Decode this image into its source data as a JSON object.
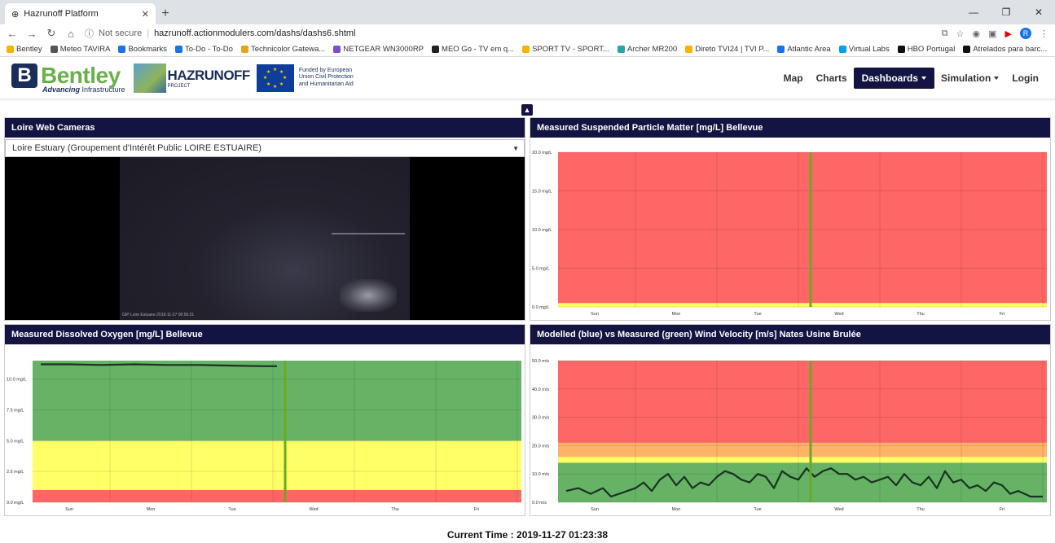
{
  "browser": {
    "tab_title": "Hazrunoff Platform",
    "secure_label": "Not secure",
    "url": "hazrunoff.actionmodulers.com/dashs/dashs6.shtml",
    "avatar_letter": "R",
    "bookmarks": [
      {
        "label": "Bentley",
        "color": "#f4b400"
      },
      {
        "label": "Meteo TAVIRA",
        "color": "#555555"
      },
      {
        "label": "Bookmarks",
        "color": "#1a73e8"
      },
      {
        "label": "To-Do - To-Do",
        "color": "#1a73e8"
      },
      {
        "label": "Technicolor Gatewa...",
        "color": "#e8a317"
      },
      {
        "label": "NETGEAR WN3000RP",
        "color": "#7b4fd1"
      },
      {
        "label": "MEO Go - TV em q...",
        "color": "#222222"
      },
      {
        "label": "SPORT TV - SPORT...",
        "color": "#f4b400"
      },
      {
        "label": "Archer MR200",
        "color": "#2aa6a6"
      },
      {
        "label": "Direto TVI24 | TVI P...",
        "color": "#f4b400"
      },
      {
        "label": "Atlantic Area",
        "color": "#1a73e8"
      },
      {
        "label": "Virtual Labs",
        "color": "#00a1f1"
      },
      {
        "label": "HBO Portugal",
        "color": "#111111"
      },
      {
        "label": "Atrelados para barc...",
        "color": "#111111"
      }
    ],
    "bookmarks_more": "»"
  },
  "header": {
    "bentley_word": "Bentley",
    "bentley_tag_bold": "Advancing",
    "bentley_tag_rest": " Infrastructure",
    "haz_title": "HAZRUNOFF",
    "haz_sub": "PROJECT",
    "eu_text": "Funded by European Union Civil Protection and Humanitarian Aid",
    "nav": {
      "map": "Map",
      "charts": "Charts",
      "dashboards": "Dashboards",
      "simulation": "Simulation",
      "login": "Login"
    }
  },
  "panels": {
    "cameras": {
      "title": "Loire Web Cameras",
      "selected": "Loire Estuary (Groupement d'Intérêt Public LOIRE ESTUAIRE)",
      "timestamp": "GIP Loire Estuaire 2019-11-27 00:56:21"
    },
    "spm": {
      "title": "Measured Suspended Particle Matter [mg/L] Bellevue"
    },
    "oxygen": {
      "title": "Measured Dissolved Oxygen [mg/L] Bellevue"
    },
    "wind": {
      "title": "Modelled (blue) vs Measured (green) Wind Velocity [m/s] Nates Usine Brulée"
    }
  },
  "footer": {
    "current_time": "Current Time : 2019-11-27  01:23:38"
  },
  "colors": {
    "red": "#ff6666",
    "green": "#66b366",
    "yellow": "#ffff66",
    "orange": "#ffb366",
    "now_line": "#6aa82a",
    "series": "#1a3320",
    "header_bg": "#141443"
  },
  "chart_data": [
    {
      "id": "spm",
      "type": "area",
      "title": "Measured Suspended Particle Matter [mg/L] Bellevue",
      "categories": [
        "Sun",
        "Mon",
        "Tue",
        "Wed",
        "Thu",
        "Fri"
      ],
      "yticks": [
        "0.0 mg/L",
        "5.0 mg/L",
        "10.0 mg/L",
        "15.0 mg/L",
        "20.0 mg/L"
      ],
      "ylim": [
        0,
        20
      ],
      "bands": [
        {
          "from": 0,
          "to": 0.5,
          "color": "yellow"
        },
        {
          "from": 0.5,
          "to": 20,
          "color": "red"
        }
      ],
      "now_x": 2.65,
      "series": []
    },
    {
      "id": "oxygen",
      "type": "line",
      "title": "Measured Dissolved Oxygen [mg/L] Bellevue",
      "categories": [
        "Sun",
        "Mon",
        "Tue",
        "Wed",
        "Thu",
        "Fri"
      ],
      "yticks": [
        "0.0 mg/L",
        "2.5 mg/L",
        "5.0 mg/L",
        "7.5 mg/L",
        "10.0 mg/L"
      ],
      "ylim": [
        0,
        11.5
      ],
      "bands": [
        {
          "from": 0,
          "to": 1,
          "color": "red"
        },
        {
          "from": 1,
          "to": 5,
          "color": "yellow"
        },
        {
          "from": 5,
          "to": 11.5,
          "color": "green"
        }
      ],
      "now_x": 2.65,
      "series": [
        {
          "x": [
            -0.35,
            0.0,
            0.4,
            0.8,
            1.2,
            1.6,
            2.0,
            2.4,
            2.55
          ],
          "y": [
            11.2,
            11.2,
            11.15,
            11.2,
            11.15,
            11.15,
            11.1,
            11.05,
            11.05
          ]
        }
      ]
    },
    {
      "id": "wind",
      "type": "line",
      "title": "Modelled (blue) vs Measured (green) Wind Velocity [m/s] Nates Usine Brulée",
      "categories": [
        "Sun",
        "Mon",
        "Tue",
        "Wed",
        "Thu",
        "Fri"
      ],
      "yticks": [
        "0.0 m/s",
        "10.0 m/s",
        "20.0 m/s",
        "30.0 m/s",
        "40.0 m/s",
        "50.0 m/s"
      ],
      "ylim": [
        0,
        50
      ],
      "bands": [
        {
          "from": 0,
          "to": 14,
          "color": "green"
        },
        {
          "from": 14,
          "to": 16,
          "color": "yellow"
        },
        {
          "from": 16,
          "to": 21,
          "color": "orange"
        },
        {
          "from": 21,
          "to": 50,
          "color": "red"
        }
      ],
      "now_x": 2.65,
      "series": [
        {
          "x": [
            -0.35,
            -0.2,
            -0.05,
            0.1,
            0.2,
            0.3,
            0.4,
            0.5,
            0.6,
            0.7,
            0.8,
            0.9,
            1.0,
            1.1,
            1.2,
            1.3,
            1.4,
            1.5,
            1.6,
            1.7,
            1.8,
            1.9,
            2.0,
            2.1,
            2.2,
            2.3,
            2.4,
            2.5,
            2.6,
            2.7,
            2.8,
            2.9,
            3.0,
            3.1,
            3.2,
            3.3,
            3.4,
            3.5,
            3.6,
            3.7,
            3.8,
            3.9,
            4.0,
            4.1,
            4.2,
            4.3,
            4.4,
            4.5,
            4.6,
            4.7,
            4.8,
            4.9,
            5.0,
            5.1,
            5.2,
            5.35,
            5.5
          ],
          "y": [
            4,
            5,
            3,
            5,
            2,
            3,
            4,
            5,
            7,
            4,
            8,
            10,
            6,
            9,
            5,
            7,
            6,
            9,
            11,
            10,
            8,
            7,
            10,
            9,
            5,
            11,
            9,
            8,
            12,
            9,
            11,
            12,
            10,
            10,
            8,
            9,
            7,
            8,
            9,
            6,
            10,
            7,
            6,
            9,
            5,
            11,
            7,
            8,
            5,
            6,
            4,
            7,
            6,
            3,
            4,
            2,
            2
          ]
        }
      ]
    }
  ]
}
